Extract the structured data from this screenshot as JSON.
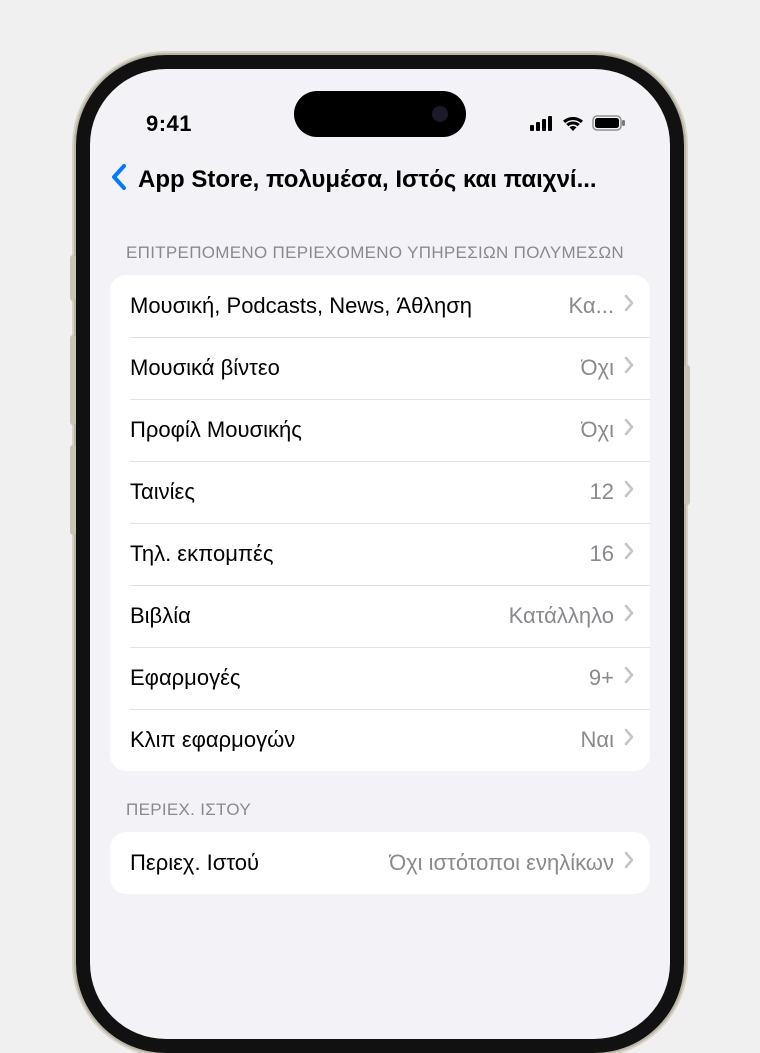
{
  "status": {
    "time": "9:41"
  },
  "nav": {
    "title": "App Store, πολυμέσα, Ιστός και παιχνί..."
  },
  "section1": {
    "header": "ΕΠΙΤΡΕΠΟΜΕΝΟ ΠΕΡΙΕΧΟΜΕΝΟ ΥΠΗΡΕΣΙΩΝ ΠΟΛΥΜΕΣΩΝ",
    "rows": [
      {
        "label": "Μουσική, Podcasts, News, Άθληση",
        "value": "Κα..."
      },
      {
        "label": "Μουσικά βίντεο",
        "value": "Όχι"
      },
      {
        "label": "Προφίλ Μουσικής",
        "value": "Όχι"
      },
      {
        "label": "Ταινίες",
        "value": "12"
      },
      {
        "label": "Τηλ. εκπομπές",
        "value": "16"
      },
      {
        "label": "Βιβλία",
        "value": "Κατάλληλο"
      },
      {
        "label": "Εφαρμογές",
        "value": "9+"
      },
      {
        "label": "Κλιπ εφαρμογών",
        "value": "Ναι"
      }
    ]
  },
  "section2": {
    "header": "ΠΕΡΙΕΧ. ΙΣΤΟΥ",
    "rows": [
      {
        "label": "Περιεχ. Ιστού",
        "value": "Όχι ιστότοποι ενηλίκων"
      }
    ]
  }
}
